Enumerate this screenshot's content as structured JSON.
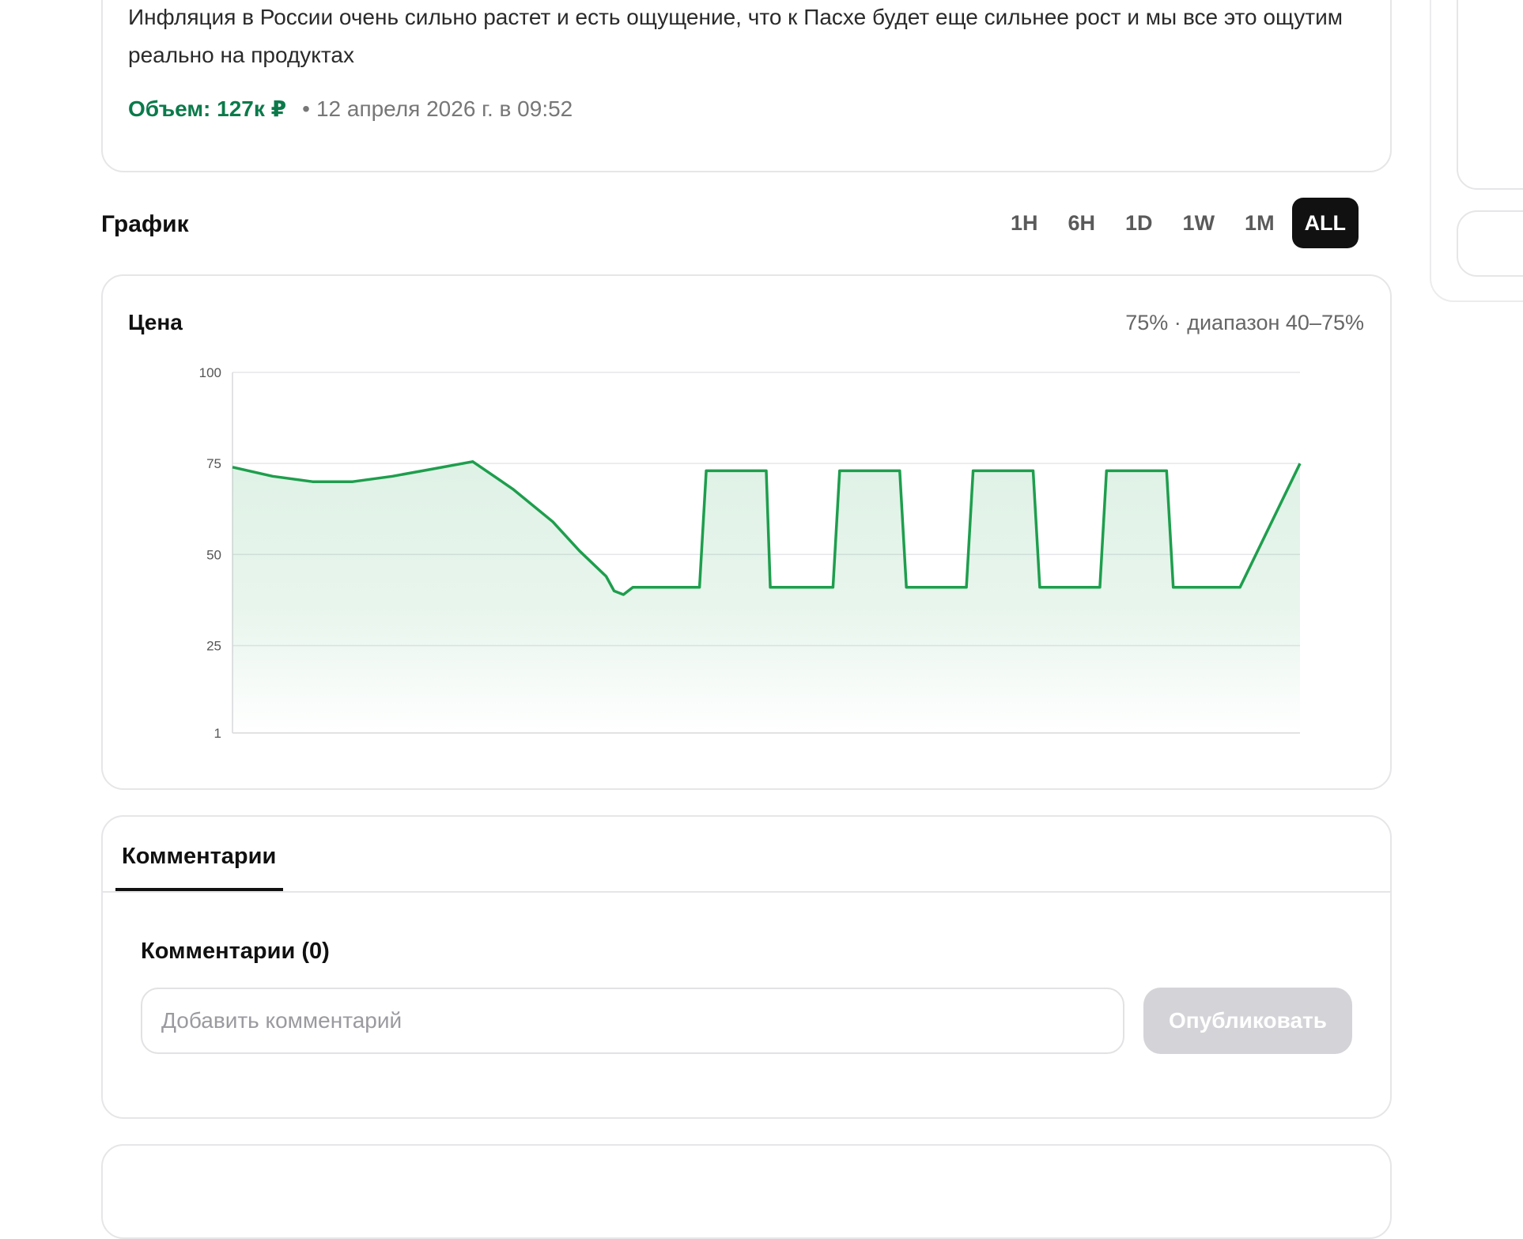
{
  "market": {
    "description": "Инфляция в России очень сильно растет и есть ощущение, что к Пасхе будет еще сильнее рост и мы все это ощутим реально на продуктах",
    "volume_label": "Объем: 127к ₽",
    "separator": "•",
    "date": "12 апреля 2026 г. в 09:52"
  },
  "chart_section": {
    "title": "График",
    "ranges": [
      {
        "label": "1H",
        "active": false
      },
      {
        "label": "6H",
        "active": false
      },
      {
        "label": "1D",
        "active": false
      },
      {
        "label": "1W",
        "active": false
      },
      {
        "label": "1M",
        "active": false
      },
      {
        "label": "ALL",
        "active": true
      }
    ]
  },
  "chart_card": {
    "title": "Цена",
    "summary": "75% · диапазон 40–75%"
  },
  "chart_data": {
    "type": "area",
    "title": "Цена",
    "xlabel": "",
    "ylabel": "",
    "ylim": [
      1,
      100
    ],
    "yticks": [
      1,
      25,
      50,
      75,
      100
    ],
    "grid": true,
    "x": [
      0,
      3,
      6,
      9,
      12,
      15,
      18,
      21,
      24,
      26,
      28,
      28.6,
      29.3,
      30,
      35,
      35.5,
      40,
      40.3,
      45,
      45.5,
      50,
      50.5,
      55,
      55.5,
      60,
      60.5,
      65,
      65.5,
      70,
      70.5,
      75,
      75.5,
      80
    ],
    "series": [
      {
        "values": [
          74,
          71.5,
          70,
          70,
          71.5,
          73.5,
          75.5,
          68,
          59,
          51,
          44,
          40,
          39,
          41,
          41,
          73,
          73,
          41,
          41,
          73,
          73,
          41,
          41,
          73,
          73,
          41,
          41,
          73,
          73,
          41,
          41,
          41,
          75
        ],
        "color": "#1e9e4d"
      }
    ]
  },
  "comments": {
    "tab_label": "Комментарии",
    "heading": "Комментарии (0)",
    "input_placeholder": "Добавить комментарий",
    "publish_label": "Опубликовать"
  }
}
